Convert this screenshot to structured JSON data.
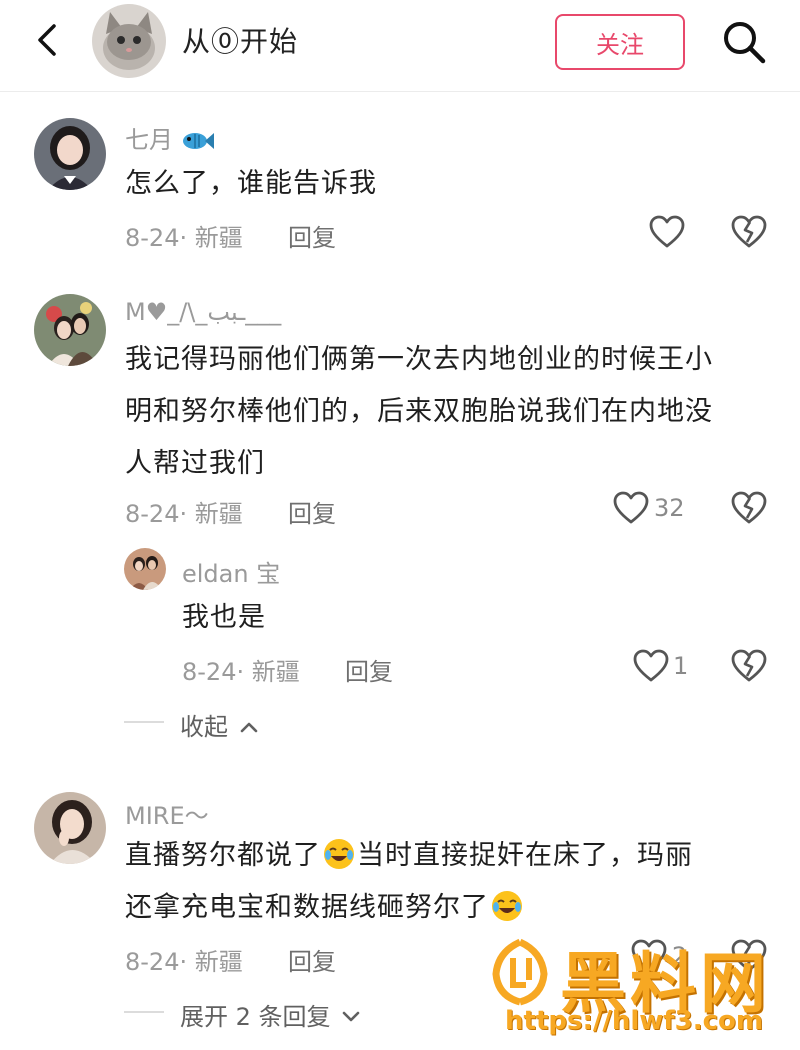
{
  "header": {
    "title": "从⓪开始",
    "follow_label": "关注"
  },
  "comments": [
    {
      "username": "七月",
      "username_icon": "fish-icon",
      "text": "怎么了，谁能告诉我",
      "date_location": "8-24· 新疆",
      "reply_label": "回复",
      "likes": ""
    },
    {
      "username": "M♥_/\\_ـبب___",
      "text_lines": [
        "我记得玛丽他们俩第一次去内地创业的时候王小",
        "明和努尔棒他们的，后来双胞胎说我们在内地没",
        "人帮过我们"
      ],
      "date_location": "8-24· 新疆",
      "reply_label": "回复",
      "likes": "32",
      "sub_reply": {
        "username": "eldan 宝",
        "text": "我也是",
        "date_location": "8-24· 新疆",
        "reply_label": "回复",
        "likes": "1"
      },
      "collapse_label": "收起"
    },
    {
      "username": "MIRE～",
      "text_line1_a": "直播努尔都说了",
      "text_line1_b": "当时直接捉奸在床了，玛丽",
      "text_line2": "还拿充电宝和数据线砸努尔了",
      "date_location": "8-24· 新疆",
      "reply_label": "回复",
      "likes": "2",
      "expand_label": "展开 2 条回复"
    }
  ],
  "watermark": {
    "text": "黑料网",
    "url": "https://hlwf3.com"
  },
  "colors": {
    "accent": "#e8486b",
    "watermark": "#f7a823"
  }
}
